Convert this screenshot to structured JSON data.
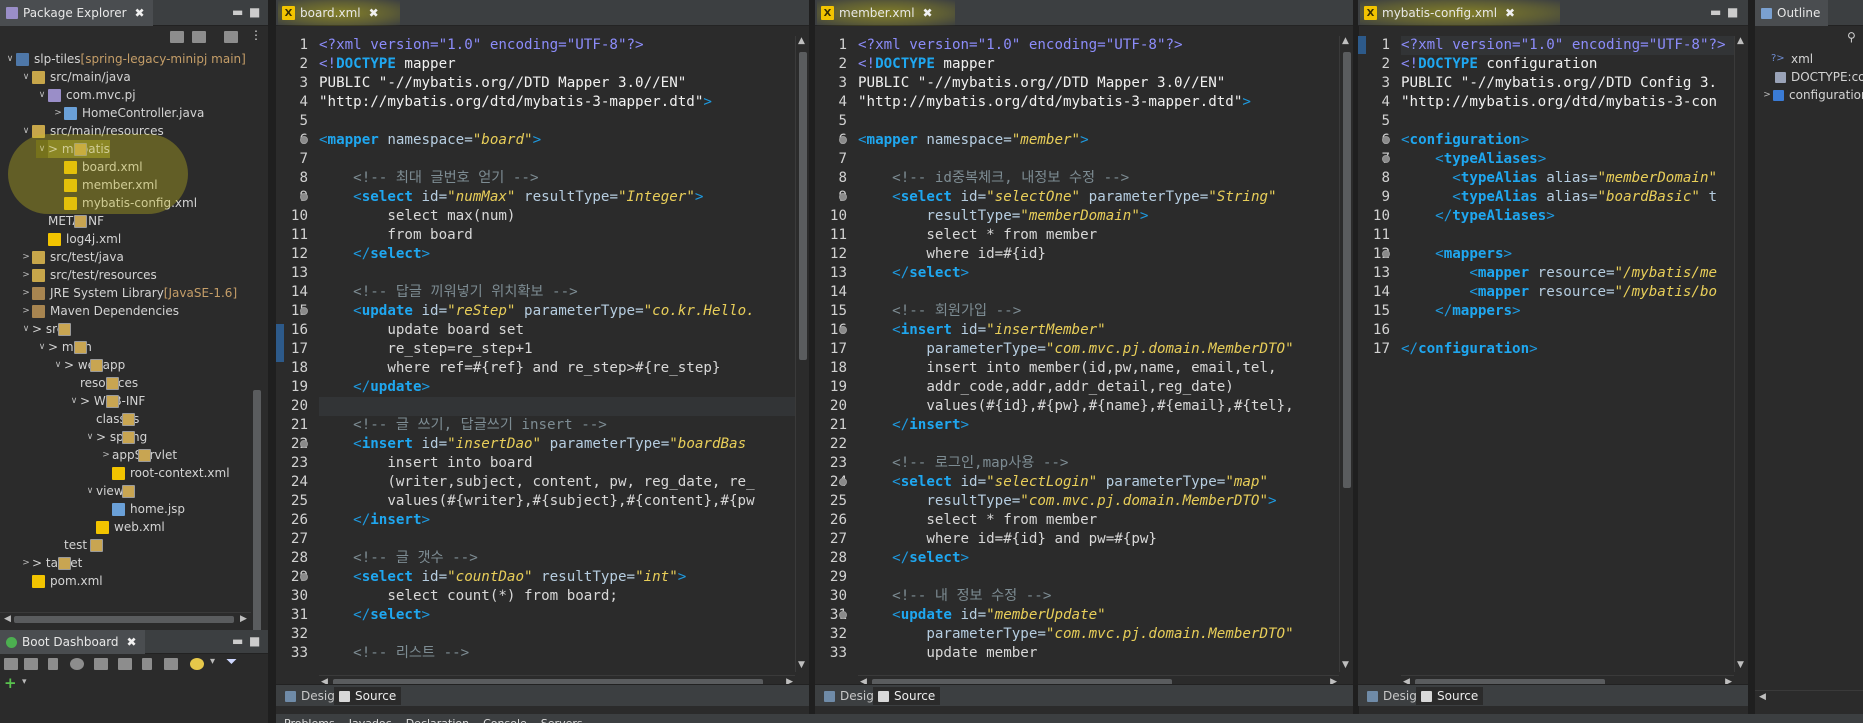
{
  "explorer": {
    "title": "Package Explorer",
    "items": [
      {
        "label": "slp-tiles",
        "extra": " [spring-legacy-minipj main]"
      },
      {
        "label": "src/main/java"
      },
      {
        "label": "com.mvc.pj"
      },
      {
        "label": "HomeController.java"
      },
      {
        "label": "src/main/resources"
      },
      {
        "label": "> mybatis"
      },
      {
        "label": "board.xml"
      },
      {
        "label": "member.xml"
      },
      {
        "label": "mybatis-config.xml"
      },
      {
        "label": "META-INF"
      },
      {
        "label": "log4j.xml"
      },
      {
        "label": "src/test/java"
      },
      {
        "label": "src/test/resources"
      },
      {
        "label": "JRE System Library",
        "extra": " [JavaSE-1.6]"
      },
      {
        "label": "Maven Dependencies"
      },
      {
        "label": "> src"
      },
      {
        "label": "> main"
      },
      {
        "label": "> webapp"
      },
      {
        "label": "resources"
      },
      {
        "label": "> WEB-INF"
      },
      {
        "label": "classes"
      },
      {
        "label": "> spring"
      },
      {
        "label": "appServlet"
      },
      {
        "label": "root-context.xml"
      },
      {
        "label": "views"
      },
      {
        "label": "home.jsp"
      },
      {
        "label": "web.xml"
      },
      {
        "label": "test"
      },
      {
        "label": "> target"
      },
      {
        "label": "pom.xml"
      }
    ]
  },
  "boot_dashboard": {
    "title": "Boot Dashboard"
  },
  "outline": {
    "title": "Outline",
    "items": [
      "xml",
      "DOCTYPE:co",
      "configuration"
    ]
  },
  "bottom_tabs": {
    "design": "Design",
    "source": "Source"
  },
  "bottom_panel": {
    "problems": "Problems",
    "javadoc": "Javadoc",
    "declaration": "Declaration",
    "console": "Console",
    "servers": "Servers"
  },
  "editors": [
    {
      "tab": "board.xml",
      "lines": [
        [
          [
            "pi",
            "<?xml version=\"1.0\" encoding=\"UTF-8\"?>"
          ]
        ],
        [
          [
            "pi",
            "<!"
          ],
          [
            "tn",
            "DOCTYPE"
          ],
          [
            "dt",
            " mapper"
          ]
        ],
        [
          [
            "dt",
            "PUBLIC \"-//mybatis.org//DTD Mapper 3.0//EN\""
          ]
        ],
        [
          [
            "dt",
            "\"http://mybatis.org/dtd/mybatis-3-mapper.dtd\""
          ],
          [
            "tag",
            ">"
          ]
        ],
        [
          [
            "tx",
            ""
          ]
        ],
        [
          [
            "tag",
            "<"
          ],
          [
            "tn",
            "mapper"
          ],
          [
            "at",
            " namespace="
          ],
          [
            "val",
            "\"board\""
          ],
          [
            "tag",
            ">"
          ]
        ],
        [
          [
            "tx",
            ""
          ]
        ],
        [
          [
            "cm",
            "    <!-- 최대 글번호 얻기 -->"
          ]
        ],
        [
          [
            "tag",
            "    <"
          ],
          [
            "tn",
            "select"
          ],
          [
            "at",
            " id="
          ],
          [
            "val",
            "\"numMax\""
          ],
          [
            "at",
            " resultType="
          ],
          [
            "val",
            "\"Integer\""
          ],
          [
            "tag",
            ">"
          ]
        ],
        [
          [
            "tx",
            "        select max(num)"
          ]
        ],
        [
          [
            "tx",
            "        from board"
          ]
        ],
        [
          [
            "tag",
            "    </"
          ],
          [
            "tn",
            "select"
          ],
          [
            "tag",
            ">"
          ]
        ],
        [
          [
            "tx",
            ""
          ]
        ],
        [
          [
            "cm",
            "    <!-- 답글 끼워넣기 위치확보 -->"
          ]
        ],
        [
          [
            "tag",
            "    <"
          ],
          [
            "tn",
            "update"
          ],
          [
            "at",
            " id="
          ],
          [
            "val",
            "\"reStep\""
          ],
          [
            "at",
            " parameterType="
          ],
          [
            "val",
            "\"co.kr.Hello."
          ]
        ],
        [
          [
            "tx",
            "        update board set"
          ]
        ],
        [
          [
            "tx",
            "        re_step=re_step+1"
          ]
        ],
        [
          [
            "tx",
            "        where ref=#{ref} and re_step>#{re_step}"
          ]
        ],
        [
          [
            "tag",
            "    </"
          ],
          [
            "tn",
            "update"
          ],
          [
            "tag",
            ">"
          ]
        ],
        [
          [
            "tx",
            ""
          ]
        ],
        [
          [
            "cm",
            "    <!-- 글 쓰기, 답글쓰기 insert -->"
          ]
        ],
        [
          [
            "tag",
            "    <"
          ],
          [
            "tn",
            "insert"
          ],
          [
            "at",
            " id="
          ],
          [
            "val",
            "\"insertDao\""
          ],
          [
            "at",
            " parameterType="
          ],
          [
            "val",
            "\"boardBas"
          ]
        ],
        [
          [
            "tx",
            "        insert into board"
          ]
        ],
        [
          [
            "tx",
            "        (writer,subject, content, pw, reg_date, re_"
          ]
        ],
        [
          [
            "tx",
            "        values(#{writer},#{subject},#{content},#{pw"
          ]
        ],
        [
          [
            "tag",
            "    </"
          ],
          [
            "tn",
            "insert"
          ],
          [
            "tag",
            ">"
          ]
        ],
        [
          [
            "tx",
            ""
          ]
        ],
        [
          [
            "cm",
            "    <!-- 글 갯수 -->"
          ]
        ],
        [
          [
            "tag",
            "    <"
          ],
          [
            "tn",
            "select"
          ],
          [
            "at",
            " id="
          ],
          [
            "val",
            "\"countDao\""
          ],
          [
            "at",
            " resultType="
          ],
          [
            "val",
            "\"int\""
          ],
          [
            "tag",
            ">"
          ]
        ],
        [
          [
            "tx",
            "        select count(*) from board;"
          ]
        ],
        [
          [
            "tag",
            "    </"
          ],
          [
            "tn",
            "select"
          ],
          [
            "tag",
            ">"
          ]
        ],
        [
          [
            "tx",
            ""
          ]
        ],
        [
          [
            "cm",
            "    <!-- 리스트 -->"
          ]
        ]
      ]
    },
    {
      "tab": "member.xml",
      "lines": [
        [
          [
            "pi",
            "<?xml version=\"1.0\" encoding=\"UTF-8\"?>"
          ]
        ],
        [
          [
            "pi",
            "<!"
          ],
          [
            "tn",
            "DOCTYPE"
          ],
          [
            "dt",
            " mapper"
          ]
        ],
        [
          [
            "dt",
            "PUBLIC \"-//mybatis.org//DTD Mapper 3.0//EN\""
          ]
        ],
        [
          [
            "dt",
            "\"http://mybatis.org/dtd/mybatis-3-mapper.dtd\""
          ],
          [
            "tag",
            ">"
          ]
        ],
        [
          [
            "tx",
            ""
          ]
        ],
        [
          [
            "tag",
            "<"
          ],
          [
            "tn",
            "mapper"
          ],
          [
            "at",
            " namespace="
          ],
          [
            "val",
            "\"member\""
          ],
          [
            "tag",
            ">"
          ]
        ],
        [
          [
            "tx",
            ""
          ]
        ],
        [
          [
            "cm",
            "    <!-- id중복체크, 내정보 수정 -->"
          ]
        ],
        [
          [
            "tag",
            "    <"
          ],
          [
            "tn",
            "select"
          ],
          [
            "at",
            " id="
          ],
          [
            "val",
            "\"selectOne\""
          ],
          [
            "at",
            " parameterType="
          ],
          [
            "val",
            "\"String\""
          ]
        ],
        [
          [
            "at",
            "        resultType="
          ],
          [
            "val",
            "\"memberDomain\""
          ],
          [
            "tag",
            ">"
          ]
        ],
        [
          [
            "tx",
            "        select * from member"
          ]
        ],
        [
          [
            "tx",
            "        where id=#{id}"
          ]
        ],
        [
          [
            "tag",
            "    </"
          ],
          [
            "tn",
            "select"
          ],
          [
            "tag",
            ">"
          ]
        ],
        [
          [
            "tx",
            ""
          ]
        ],
        [
          [
            "cm",
            "    <!-- 회원가입 -->"
          ]
        ],
        [
          [
            "tag",
            "    <"
          ],
          [
            "tn",
            "insert"
          ],
          [
            "at",
            " id="
          ],
          [
            "val",
            "\"insertMember\""
          ]
        ],
        [
          [
            "at",
            "        parameterType="
          ],
          [
            "val",
            "\"com.mvc.pj.domain.MemberDTO\""
          ]
        ],
        [
          [
            "tx",
            "        insert into member(id,pw,name, email,tel,"
          ]
        ],
        [
          [
            "tx",
            "        addr_code,addr,addr_detail,reg_date)"
          ]
        ],
        [
          [
            "tx",
            "        values(#{id},#{pw},#{name},#{email},#{tel},"
          ]
        ],
        [
          [
            "tag",
            "    </"
          ],
          [
            "tn",
            "insert"
          ],
          [
            "tag",
            ">"
          ]
        ],
        [
          [
            "tx",
            ""
          ]
        ],
        [
          [
            "cm",
            "    <!-- 로그인,map사용 -->"
          ]
        ],
        [
          [
            "tag",
            "    <"
          ],
          [
            "tn",
            "select"
          ],
          [
            "at",
            " id="
          ],
          [
            "val",
            "\"selectLogin\""
          ],
          [
            "at",
            " parameterType="
          ],
          [
            "val",
            "\"map\""
          ]
        ],
        [
          [
            "at",
            "        resultType="
          ],
          [
            "val",
            "\"com.mvc.pj.domain.MemberDTO\""
          ],
          [
            "tag",
            ">"
          ]
        ],
        [
          [
            "tx",
            "        select * from member"
          ]
        ],
        [
          [
            "tx",
            "        where id=#{id} and pw=#{pw}"
          ]
        ],
        [
          [
            "tag",
            "    </"
          ],
          [
            "tn",
            "select"
          ],
          [
            "tag",
            ">"
          ]
        ],
        [
          [
            "tx",
            ""
          ]
        ],
        [
          [
            "cm",
            "    <!-- 내 정보 수정 -->"
          ]
        ],
        [
          [
            "tag",
            "    <"
          ],
          [
            "tn",
            "update"
          ],
          [
            "at",
            " id="
          ],
          [
            "val",
            "\"memberUpdate\""
          ]
        ],
        [
          [
            "at",
            "        parameterType="
          ],
          [
            "val",
            "\"com.mvc.pj.domain.MemberDTO\""
          ]
        ],
        [
          [
            "tx",
            "        update member"
          ]
        ]
      ]
    },
    {
      "tab": "mybatis-config.xml",
      "lines": [
        [
          [
            "pi",
            "<?xml version=\"1.0\" encoding=\"UTF-8\"?>"
          ]
        ],
        [
          [
            "pi",
            "<!"
          ],
          [
            "tn",
            "DOCTYPE"
          ],
          [
            "dt",
            " configuration"
          ]
        ],
        [
          [
            "dt",
            "PUBLIC \"-//mybatis.org//DTD Config 3."
          ]
        ],
        [
          [
            "dt",
            "\"http://mybatis.org/dtd/mybatis-3-con"
          ]
        ],
        [
          [
            "tx",
            ""
          ]
        ],
        [
          [
            "tag",
            "<"
          ],
          [
            "tn",
            "configuration"
          ],
          [
            "tag",
            ">"
          ]
        ],
        [
          [
            "tag",
            "    <"
          ],
          [
            "tn",
            "typeAliases"
          ],
          [
            "tag",
            ">"
          ]
        ],
        [
          [
            "tag",
            "      <"
          ],
          [
            "tn",
            "typeAlias"
          ],
          [
            "at",
            " alias="
          ],
          [
            "val",
            "\"memberDomain\""
          ]
        ],
        [
          [
            "tag",
            "      <"
          ],
          [
            "tn",
            "typeAlias"
          ],
          [
            "at",
            " alias="
          ],
          [
            "val",
            "\"boardBasic\""
          ],
          [
            "at",
            " t"
          ]
        ],
        [
          [
            "tag",
            "    </"
          ],
          [
            "tn",
            "typeAliases"
          ],
          [
            "tag",
            ">"
          ]
        ],
        [
          [
            "tx",
            ""
          ]
        ],
        [
          [
            "tag",
            "    <"
          ],
          [
            "tn",
            "mappers"
          ],
          [
            "tag",
            ">"
          ]
        ],
        [
          [
            "tag",
            "        <"
          ],
          [
            "tn",
            "mapper"
          ],
          [
            "at",
            " resource="
          ],
          [
            "val",
            "\"/mybatis/me"
          ]
        ],
        [
          [
            "tag",
            "        <"
          ],
          [
            "tn",
            "mapper"
          ],
          [
            "at",
            " resource="
          ],
          [
            "val",
            "\"/mybatis/bo"
          ]
        ],
        [
          [
            "tag",
            "    </"
          ],
          [
            "tn",
            "mappers"
          ],
          [
            "tag",
            ">"
          ]
        ],
        [
          [
            "tx",
            ""
          ]
        ],
        [
          [
            "tag",
            "</"
          ],
          [
            "tn",
            "configuration"
          ],
          [
            "tag",
            ">"
          ]
        ]
      ]
    }
  ]
}
